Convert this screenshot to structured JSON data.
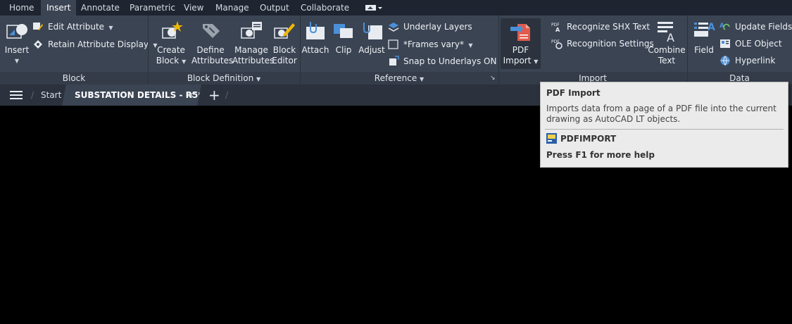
{
  "ribbon_tabs": [
    "Home",
    "Insert",
    "Annotate",
    "Parametric",
    "View",
    "Manage",
    "Output",
    "Collaborate"
  ],
  "active_tab": "Insert",
  "panels": {
    "block": {
      "title": "Block",
      "insert_label": "Insert",
      "edit_attribute_label": "Edit Attribute",
      "retain_attribute_display_label": "Retain Attribute Display"
    },
    "block_definition": {
      "title": "Block Definition",
      "create_block_label_1": "Create",
      "create_block_label_2": "Block",
      "define_attributes_label_1": "Define",
      "define_attributes_label_2": "Attributes",
      "manage_attributes_label_1": "Manage",
      "manage_attributes_label_2": "Attributes",
      "block_editor_label_1": "Block",
      "block_editor_label_2": "Editor"
    },
    "reference": {
      "title": "Reference",
      "attach_label": "Attach",
      "clip_label": "Clip",
      "adjust_label": "Adjust",
      "underlay_layers_label": "Underlay Layers",
      "frames_label": "*Frames vary*",
      "snap_label": "Snap to Underlays ON"
    },
    "import": {
      "title": "Import",
      "pdf_import_label_1": "PDF",
      "pdf_import_label_2": "Import",
      "recognize_shx_label": "Recognize SHX Text",
      "recognition_settings_label": "Recognition Settings",
      "combine_text_label_1": "Combine",
      "combine_text_label_2": "Text"
    },
    "data": {
      "title": "Data",
      "field_label": "Field",
      "update_fields_label": "Update Fields",
      "ole_object_label": "OLE Object",
      "hyperlink_label": "Hyperlink"
    }
  },
  "file_tabs": {
    "start_label": "Start",
    "active_file_label": "SUBSTATION DETAILS - R5*"
  },
  "tooltip": {
    "title": "PDF Import",
    "description": "Imports data from a page of a PDF file into the current drawing as AutoCAD LT objects.",
    "command": "PDFIMPORT",
    "help": "Press F1 for more help"
  },
  "colors": {
    "ribbon_bg": "#3b4453",
    "tab_bar_bg": "#1e2530",
    "canvas_bg": "#000000",
    "tooltip_bg": "#ebebeb",
    "accent_blue": "#4a90d9"
  }
}
